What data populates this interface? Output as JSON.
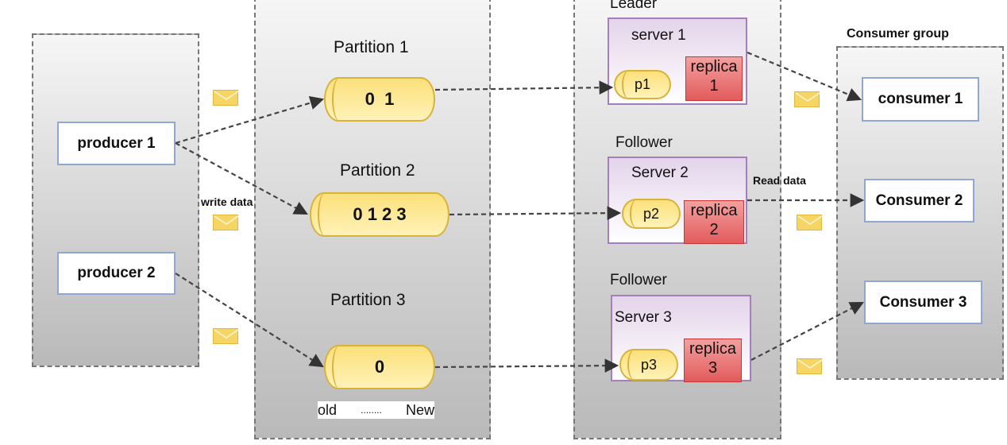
{
  "producers": {
    "items": [
      {
        "label": "producer 1"
      },
      {
        "label": "producer 2"
      }
    ],
    "edge_label": "write data"
  },
  "topic": {
    "partitions": [
      {
        "label": "Partition 1",
        "offsets": "0  1"
      },
      {
        "label": "Partition 2",
        "offsets": "0 1 2 3"
      },
      {
        "label": "Partition 3",
        "offsets": "0"
      }
    ],
    "order_old": "old",
    "order_dots": "........",
    "order_new": "New"
  },
  "brokers": [
    {
      "role": "Leader",
      "server": "server 1",
      "partition": "p1",
      "replica_label": "replica",
      "replica_num": "1"
    },
    {
      "role": "Follower",
      "server": "Server 2",
      "partition": "p2",
      "replica_label": "replica",
      "replica_num": "2"
    },
    {
      "role": "Follower",
      "server": "Server 3",
      "partition": "p3",
      "replica_label": "replica",
      "replica_num": "3"
    }
  ],
  "consumers": {
    "group_label": "Consumer group",
    "items": [
      {
        "label": "consumer 1"
      },
      {
        "label": "Consumer 2"
      },
      {
        "label": "Consumer 3"
      }
    ],
    "edge_label": "Read data"
  },
  "icons": {
    "message": "envelope-icon"
  },
  "colors": {
    "cylinder": "#fbe07a",
    "replica": "#e25b5b",
    "server_border": "#a57fbd",
    "node_border": "#8fa8d2"
  }
}
